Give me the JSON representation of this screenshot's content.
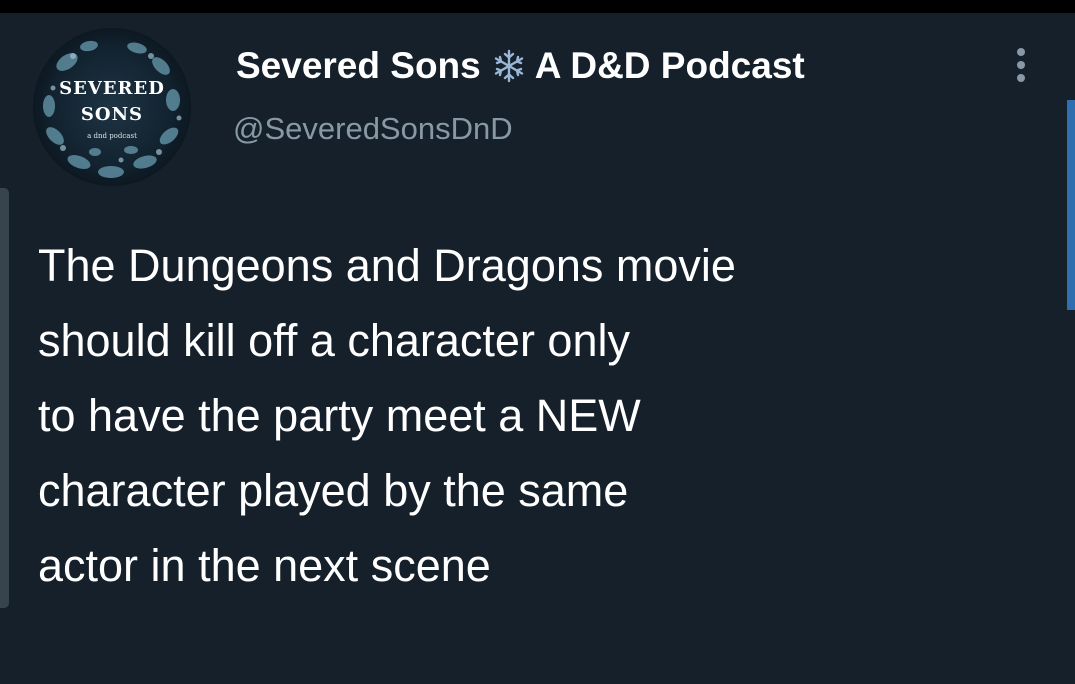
{
  "tweet": {
    "author": {
      "name": "Severed Sons",
      "name_suffix": "A D&D Podcast",
      "name_icon": "snowflake-icon",
      "handle": "@SeveredSonsDnD",
      "avatar": {
        "title_line1": "SEVERED",
        "title_line2": "SONS",
        "tagline": "a dnd podcast"
      }
    },
    "more_icon": "more-vertical-icon",
    "text_lines": [
      "The Dungeons and Dragons movie",
      "should kill off a character only",
      "to have the party meet a NEW",
      "character played by the same",
      "actor in the next scene"
    ]
  },
  "colors": {
    "background": "#15202b",
    "text_primary": "#ffffff",
    "text_secondary": "#8899a6",
    "accent": "#2f6fb0"
  }
}
